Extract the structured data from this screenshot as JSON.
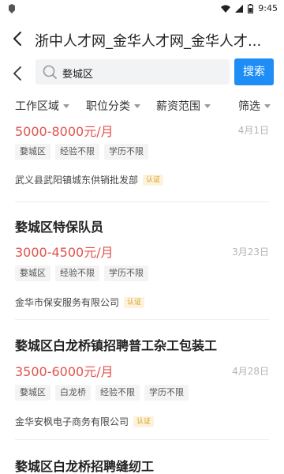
{
  "status_bar": {
    "time": "9:45"
  },
  "header": {
    "title": "浙中人才网_金华人才网_金华人才..."
  },
  "search": {
    "value": "婺城区",
    "button_label": "搜索"
  },
  "filters": [
    {
      "label": "工作区域"
    },
    {
      "label": "职位分类"
    },
    {
      "label": "薪资范围"
    },
    {
      "label": "筛选"
    }
  ],
  "jobs": [
    {
      "title": "",
      "salary": "5000-8000元/月",
      "date": "4月1日",
      "tags": [
        "婺城区",
        "经验不限",
        "学历不限"
      ],
      "company": "武义县武阳镇城东供销批发部",
      "badge": "认证"
    },
    {
      "title": "婺城区特保队员",
      "salary": "3000-4500元/月",
      "date": "3月23日",
      "tags": [
        "婺城区",
        "经验不限",
        "学历不限"
      ],
      "company": "金华市保安服务有限公司",
      "badge": "认证"
    },
    {
      "title": "婺城区白龙桥镇招聘普工杂工包装工",
      "salary": "3500-6000元/月",
      "date": "4月28日",
      "tags": [
        "婺城区",
        "白龙桥",
        "经验不限",
        "学历不限"
      ],
      "company": "金华安枫电子商务有限公司",
      "badge": "认证"
    },
    {
      "title": "婺城区白龙桥招聘缝纫工"
    }
  ],
  "colors": {
    "accent": "#1e8df5",
    "salary": "#e2524e",
    "badge_bg": "#fdf3dc",
    "badge_text": "#d59c27"
  }
}
